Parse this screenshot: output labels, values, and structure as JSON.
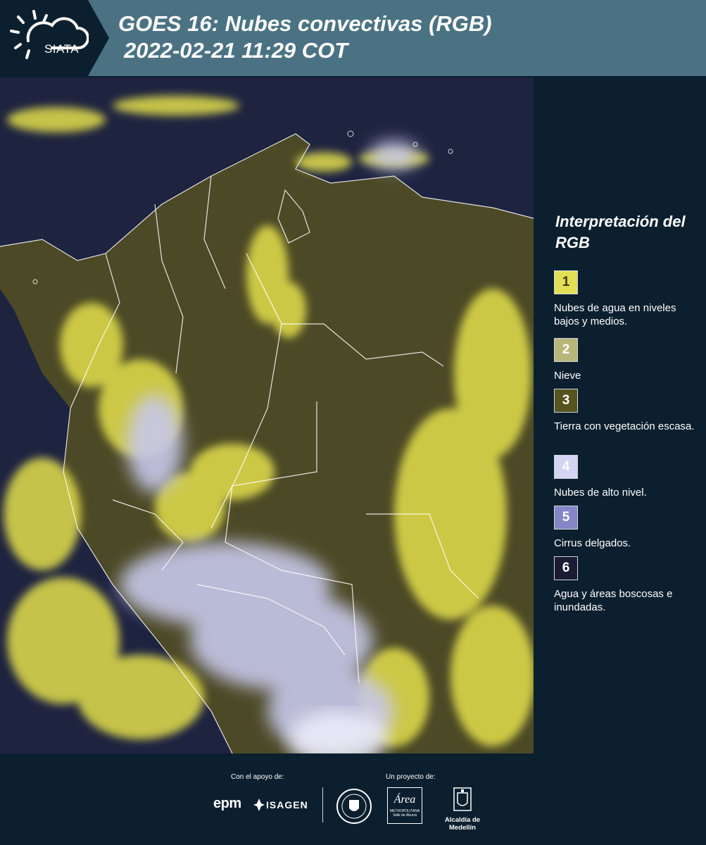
{
  "header": {
    "logo_text": "SIATA",
    "title_line1": "GOES 16: Nubes convectivas (RGB)",
    "title_line2": "2022-02-21 11:29 COT"
  },
  "map": {
    "icon": "satellite-rgb-map-colombia",
    "colors": {
      "background": "#1e2340",
      "low_clouds": "#e6e24a",
      "land": "#5f5e2a",
      "high_clouds": "#c9cbec",
      "borders": "#ffffff"
    }
  },
  "legend": {
    "title": "Interpretación del RGB",
    "items": [
      {
        "number": "1",
        "label": "Nubes de agua en niveles bajos y medios.",
        "color": "#e3df55",
        "text_color": "#3a3a10"
      },
      {
        "number": "2",
        "label": "Nieve",
        "color": "#b9b67a",
        "text_color": "#ffffff"
      },
      {
        "number": "3",
        "label": "Tierra con vegetación escasa.",
        "color": "#56541f",
        "text_color": "#ffffff"
      },
      {
        "number": "4",
        "label": "Nubes de alto nivel.",
        "color": "#d3d3f2",
        "text_color": "#ffffff"
      },
      {
        "number": "5",
        "label": "Cirrus delgados.",
        "color": "#8486c8",
        "text_color": "#ffffff"
      },
      {
        "number": "6",
        "label": "Agua y áreas boscosas e inundadas.",
        "color": "#1c1b34",
        "text_color": "#ffffff"
      }
    ]
  },
  "footer": {
    "support_caption": "Con el apoyo de:",
    "project_caption": "Un proyecto de:",
    "epm": "epm",
    "isagen": "ISAGEN",
    "area_logo_text": "Área",
    "area_logo_sub": "METROPOLITANA Valle de Aburrá",
    "alcaldia": "Alcaldía de Medellín"
  }
}
